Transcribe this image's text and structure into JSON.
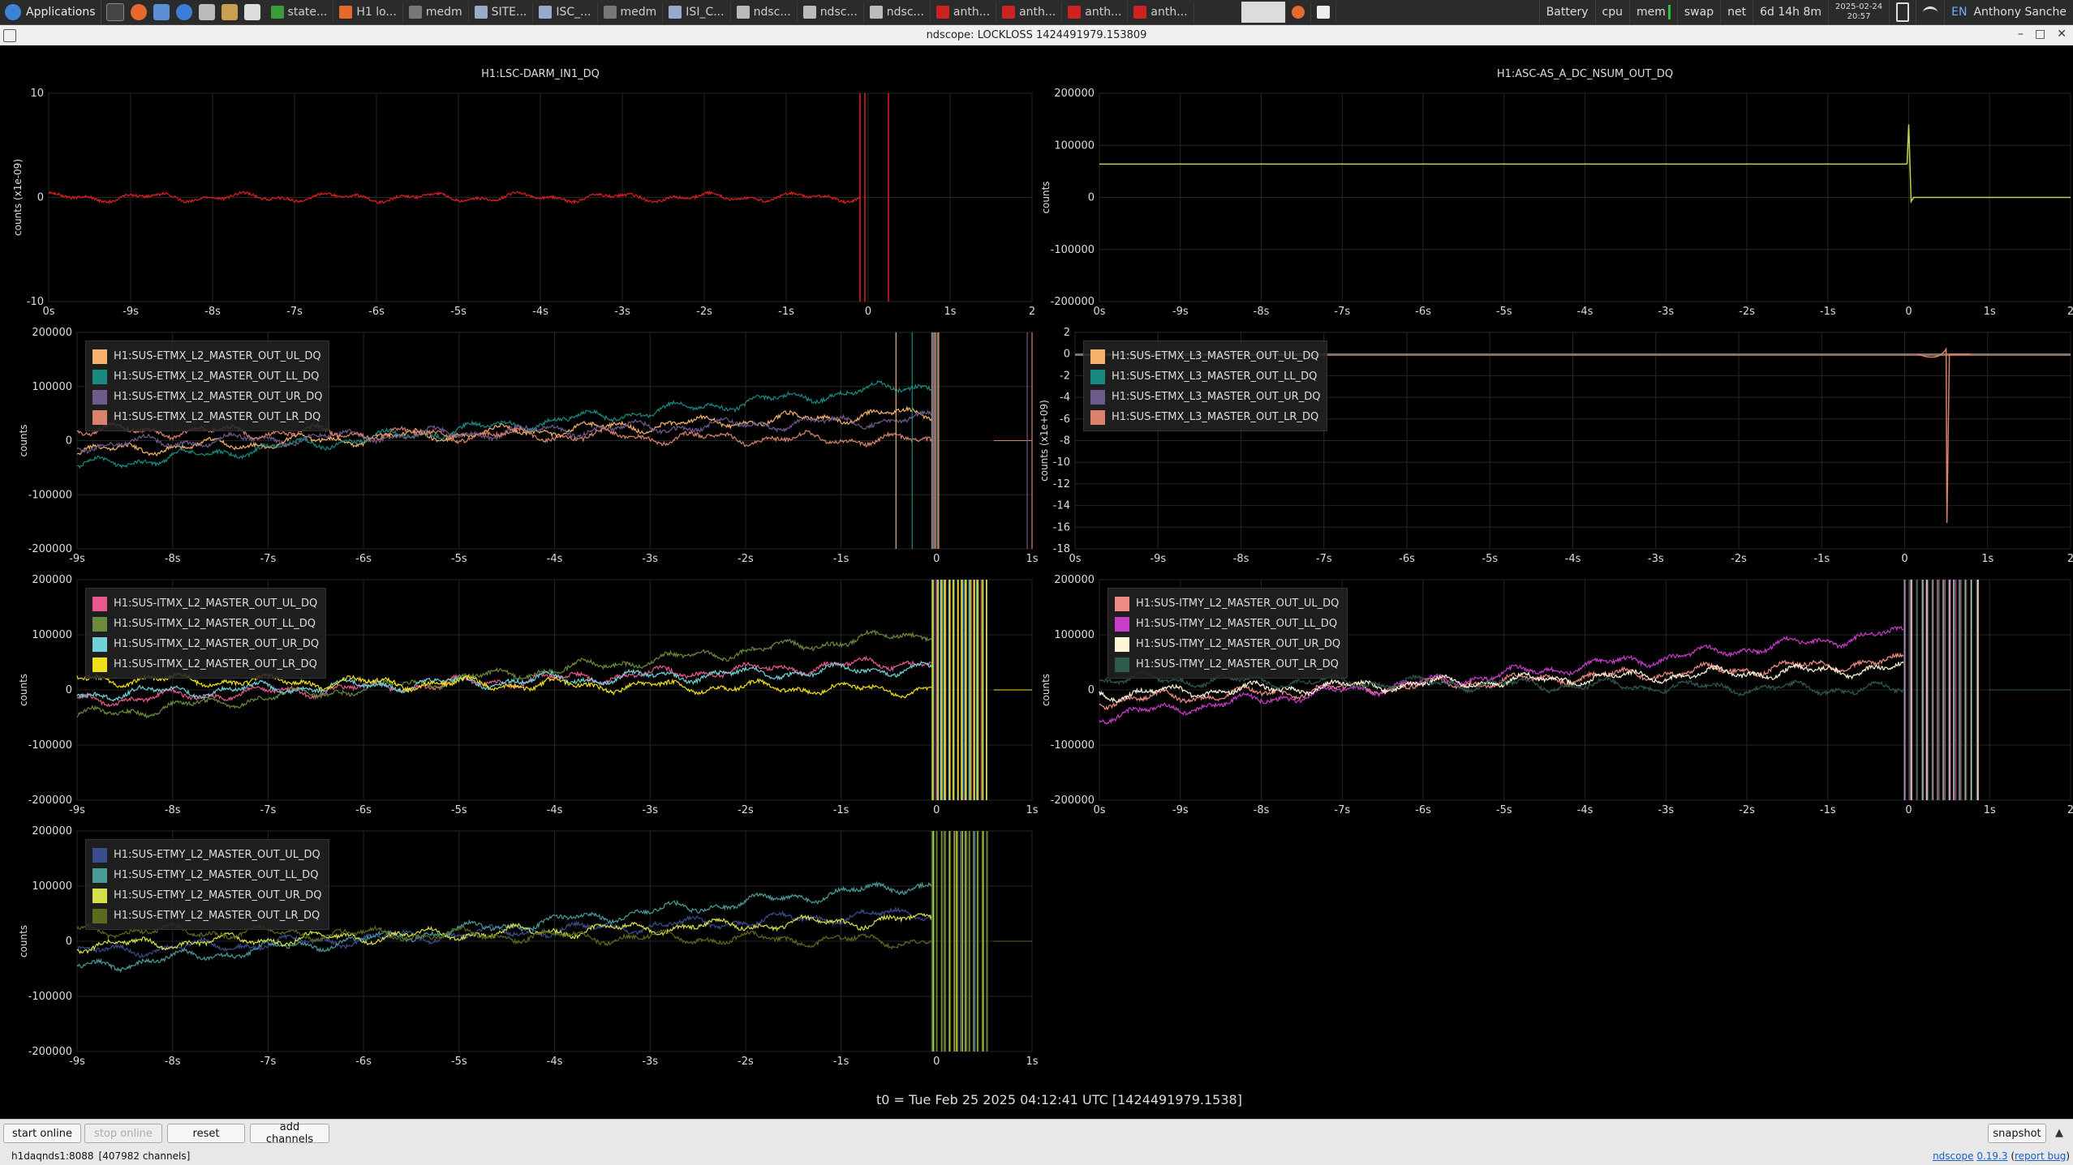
{
  "taskbar": {
    "apps_label": "Applications",
    "tasks": [
      {
        "label": "state...",
        "color": "#3c9a3c"
      },
      {
        "label": "H1 lo...",
        "color": "#e8692c"
      },
      {
        "label": "medm",
        "color": "#777777"
      },
      {
        "label": "SITE...",
        "color": "#99aacc"
      },
      {
        "label": "ISC_...",
        "color": "#99aacc"
      },
      {
        "label": "medm",
        "color": "#777777"
      },
      {
        "label": "ISI_C...",
        "color": "#99aacc"
      },
      {
        "label": "ndsc...",
        "color": "#bbbbbb"
      },
      {
        "label": "ndsc...",
        "color": "#bbbbbb"
      },
      {
        "label": "ndsc...",
        "color": "#bbbbbb"
      },
      {
        "label": "anth...",
        "color": "#cc2222"
      },
      {
        "label": "anth...",
        "color": "#cc2222"
      },
      {
        "label": "anth...",
        "color": "#cc2222"
      },
      {
        "label": "anth...",
        "color": "#cc2222"
      }
    ],
    "tray": {
      "battery": "Battery",
      "cpu": "cpu",
      "mem": "mem",
      "swap": "swap",
      "net": "net",
      "uptime": "6d 14h 8m",
      "date": "2025-02-24",
      "time": "20:57",
      "lang": "EN",
      "user": "Anthony Sanche"
    }
  },
  "window": {
    "title": "ndscope: LOCKLOSS 1424491979.153809"
  },
  "plots": [
    {
      "id": "darm",
      "title": "H1:LSC-DARM_IN1_DQ",
      "ylabel": "counts (x1e-09)",
      "yticks": [
        "10",
        "0",
        "-10"
      ],
      "xticks": [
        "0s",
        "-9s",
        "-8s",
        "-7s",
        "-6s",
        "-5s",
        "-4s",
        "-3s",
        "-2s",
        "-1s",
        "0",
        "1s",
        "2"
      ],
      "legend": []
    },
    {
      "id": "asc",
      "title": "H1:ASC-AS_A_DC_NSUM_OUT_DQ",
      "ylabel": "counts",
      "yticks": [
        "200000",
        "100000",
        "0",
        "-100000",
        "-200000"
      ],
      "xticks": [
        "0s",
        "-9s",
        "-8s",
        "-7s",
        "-6s",
        "-5s",
        "-4s",
        "-3s",
        "-2s",
        "-1s",
        "0",
        "1s",
        "2"
      ],
      "legend": []
    },
    {
      "id": "etmx_l2",
      "title": "",
      "ylabel": "counts",
      "yticks": [
        "200000",
        "100000",
        "0",
        "-100000",
        "-200000"
      ],
      "xticks": [
        "-9s",
        "-8s",
        "-7s",
        "-6s",
        "-5s",
        "-4s",
        "-3s",
        "-2s",
        "-1s",
        "0",
        "1s"
      ],
      "legend": [
        {
          "name": "H1:SUS-ETMX_L2_MASTER_OUT_UL_DQ",
          "color": "#f6b26b"
        },
        {
          "name": "H1:SUS-ETMX_L2_MASTER_OUT_LL_DQ",
          "color": "#1a8a80"
        },
        {
          "name": "H1:SUS-ETMX_L2_MASTER_OUT_UR_DQ",
          "color": "#6e5a8c"
        },
        {
          "name": "H1:SUS-ETMX_L2_MASTER_OUT_LR_DQ",
          "color": "#d9826c"
        }
      ]
    },
    {
      "id": "etmx_l3",
      "title": "",
      "ylabel": "counts (x1e+09)",
      "yticks": [
        "2",
        "0",
        "-2",
        "-4",
        "-6",
        "-8",
        "-10",
        "-12",
        "-14",
        "-16",
        "-18"
      ],
      "xticks": [
        "0s",
        "-9s",
        "-8s",
        "-7s",
        "-6s",
        "-5s",
        "-4s",
        "-3s",
        "-2s",
        "-1s",
        "0",
        "1s",
        "2"
      ],
      "legend": [
        {
          "name": "H1:SUS-ETMX_L3_MASTER_OUT_UL_DQ",
          "color": "#f6b26b"
        },
        {
          "name": "H1:SUS-ETMX_L3_MASTER_OUT_LL_DQ",
          "color": "#1a8a80"
        },
        {
          "name": "H1:SUS-ETMX_L3_MASTER_OUT_UR_DQ",
          "color": "#6e5a8c"
        },
        {
          "name": "H1:SUS-ETMX_L3_MASTER_OUT_LR_DQ",
          "color": "#d9826c"
        }
      ]
    },
    {
      "id": "itmx_l2",
      "title": "",
      "ylabel": "counts",
      "yticks": [
        "200000",
        "100000",
        "0",
        "-100000",
        "-200000"
      ],
      "xticks": [
        "-9s",
        "-8s",
        "-7s",
        "-6s",
        "-5s",
        "-4s",
        "-3s",
        "-2s",
        "-1s",
        "0",
        "1s"
      ],
      "legend": [
        {
          "name": "H1:SUS-ITMX_L2_MASTER_OUT_UL_DQ",
          "color": "#e8588f"
        },
        {
          "name": "H1:SUS-ITMX_L2_MASTER_OUT_LL_DQ",
          "color": "#6a8a3c"
        },
        {
          "name": "H1:SUS-ITMX_L2_MASTER_OUT_UR_DQ",
          "color": "#6fd2d8"
        },
        {
          "name": "H1:SUS-ITMX_L2_MASTER_OUT_LR_DQ",
          "color": "#f2df1b"
        }
      ]
    },
    {
      "id": "itmy_l2",
      "title": "",
      "ylabel": "counts",
      "yticks": [
        "200000",
        "100000",
        "0",
        "-100000",
        "-200000"
      ],
      "xticks": [
        "0s",
        "-9s",
        "-8s",
        "-7s",
        "-6s",
        "-5s",
        "-4s",
        "-3s",
        "-2s",
        "-1s",
        "0",
        "1s",
        "2"
      ],
      "legend": [
        {
          "name": "H1:SUS-ITMY_L2_MASTER_OUT_UL_DQ",
          "color": "#f08c84"
        },
        {
          "name": "H1:SUS-ITMY_L2_MASTER_OUT_LL_DQ",
          "color": "#c83cc8"
        },
        {
          "name": "H1:SUS-ITMY_L2_MASTER_OUT_UR_DQ",
          "color": "#fff6d8"
        },
        {
          "name": "H1:SUS-ITMY_L2_MASTER_OUT_LR_DQ",
          "color": "#2e5a4e"
        }
      ]
    },
    {
      "id": "etmy_l2",
      "title": "",
      "ylabel": "counts",
      "yticks": [
        "200000",
        "100000",
        "0",
        "-100000",
        "-200000"
      ],
      "xticks": [
        "-9s",
        "-8s",
        "-7s",
        "-6s",
        "-5s",
        "-4s",
        "-3s",
        "-2s",
        "-1s",
        "0",
        "1s"
      ],
      "legend": [
        {
          "name": "H1:SUS-ETMY_L2_MASTER_OUT_UL_DQ",
          "color": "#3a4d8c"
        },
        {
          "name": "H1:SUS-ETMY_L2_MASTER_OUT_LL_DQ",
          "color": "#4a9a96"
        },
        {
          "name": "H1:SUS-ETMY_L2_MASTER_OUT_UR_DQ",
          "color": "#d6e04a"
        },
        {
          "name": "H1:SUS-ETMY_L2_MASTER_OUT_LR_DQ",
          "color": "#5a6a1e"
        }
      ]
    }
  ],
  "t0_label": "t0 = Tue Feb 25 2025 04:12:41 UTC [1424491979.1538]",
  "buttons": {
    "start_online": "start online",
    "stop_online": "stop online",
    "reset": "reset",
    "add_channels": "add channels",
    "snapshot": "snapshot"
  },
  "status": {
    "server": "h1daqnds1:8088",
    "channels": "[407982 channels]",
    "app_name": "ndscope",
    "version": "0.19.3",
    "report_bug": "report bug"
  },
  "colors": {
    "darm_trace": "#e02020",
    "asc_trace": "#c8d24a",
    "grid": "#262626",
    "axis": "#888888"
  }
}
